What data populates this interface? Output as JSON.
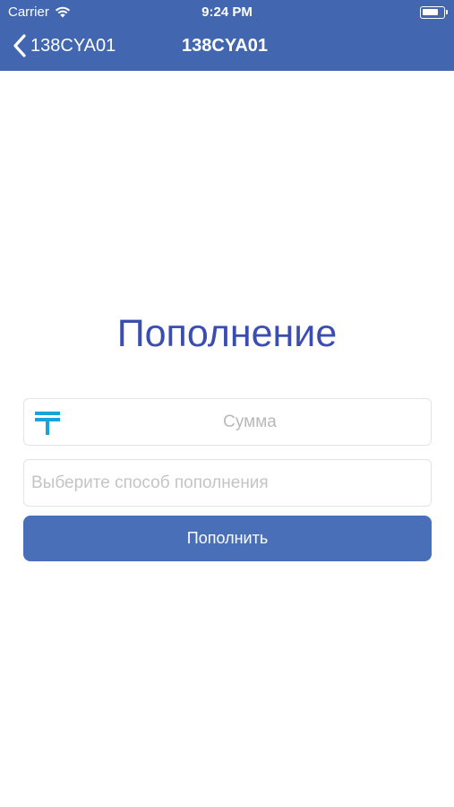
{
  "status_bar": {
    "carrier": "Carrier",
    "time": "9:24 PM",
    "wifi_icon": "wifi-icon",
    "battery_icon": "battery-icon"
  },
  "nav": {
    "back_label": "138CYA01",
    "title": "138CYA01",
    "back_icon": "chevron-left-icon",
    "bar_color": "#4267b0"
  },
  "page": {
    "heading": "Пополнение",
    "heading_color": "#3c4db0"
  },
  "form": {
    "amount": {
      "icon": "tenge-icon",
      "icon_color": "#1aa3d9",
      "placeholder": "Сумма",
      "value": ""
    },
    "method": {
      "placeholder": "Выберите способ пополнения",
      "value": ""
    },
    "submit_label": "Пополнить",
    "submit_color": "#4a6fb9"
  }
}
